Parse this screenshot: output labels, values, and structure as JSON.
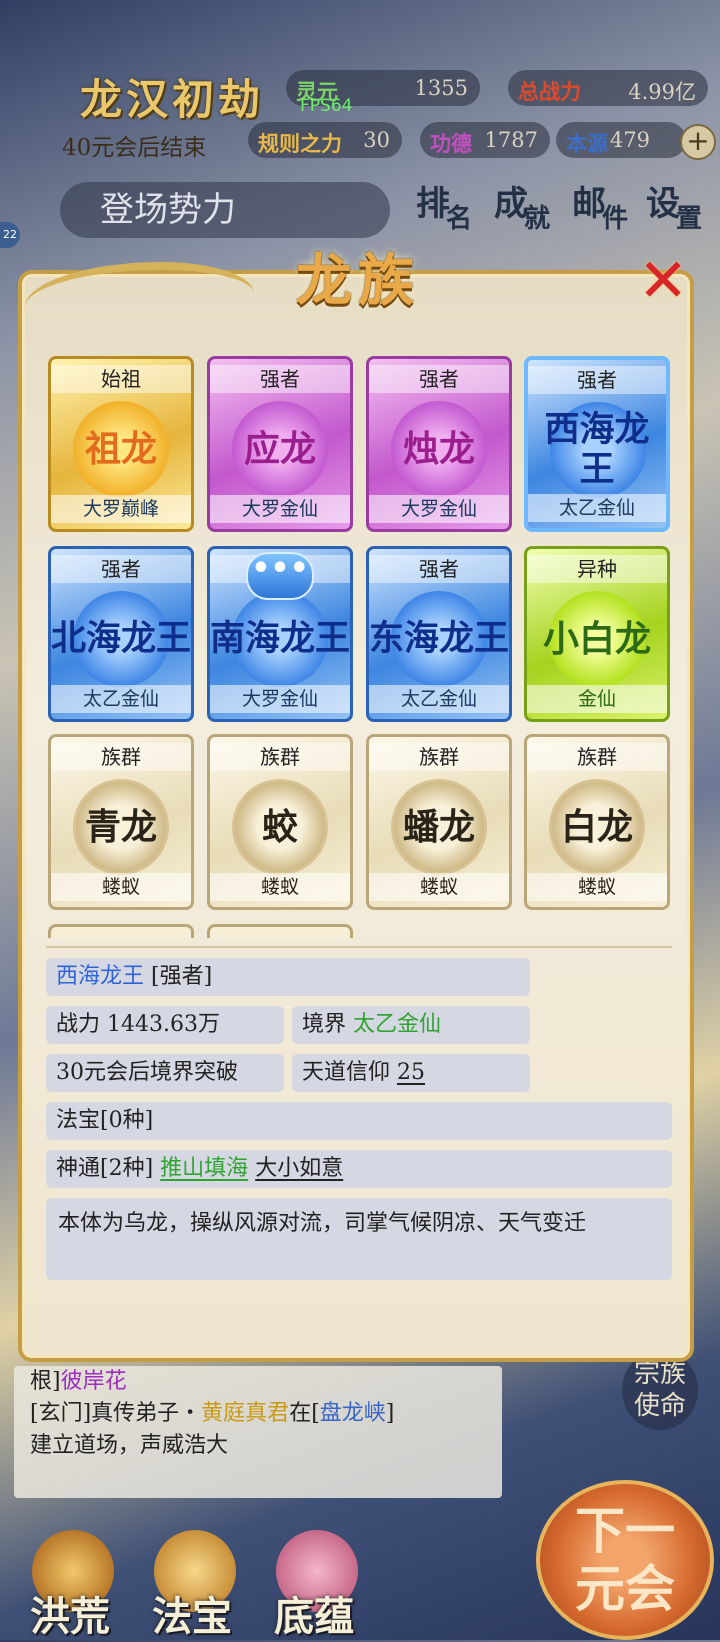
{
  "hud": {
    "title": "龙汉初劫",
    "subtitle": "40元会后结束",
    "fps": "FPS64",
    "stats": [
      {
        "key": "灵元",
        "value": "1355"
      },
      {
        "key": "总战力",
        "value": "4.99亿"
      },
      {
        "key": "规则之力",
        "value": "30"
      },
      {
        "key": "功德",
        "value": "1787"
      },
      {
        "key": "本源",
        "value": "479"
      }
    ],
    "plus": "+",
    "faction_label": "登场势力",
    "level_badge": "22",
    "buttons": [
      {
        "c1": "排",
        "c2": "名"
      },
      {
        "c1": "成",
        "c2": "就"
      },
      {
        "c1": "邮",
        "c2": "件"
      },
      {
        "c1": "设",
        "c2": "置"
      }
    ]
  },
  "modal": {
    "title": "龙族",
    "close_icon": "close-x-icon",
    "cards": [
      {
        "rank": "始祖",
        "name": "祖龙",
        "realm": "大罗巅峰",
        "tier": "gold"
      },
      {
        "rank": "强者",
        "name": "应龙",
        "realm": "大罗金仙",
        "tier": "purple"
      },
      {
        "rank": "强者",
        "name": "烛龙",
        "realm": "大罗金仙",
        "tier": "purple"
      },
      {
        "rank": "强者",
        "name": "西海龙王",
        "realm": "太乙金仙",
        "tier": "blue"
      },
      {
        "rank": "强者",
        "name": "北海龙王",
        "realm": "太乙金仙",
        "tier": "blue"
      },
      {
        "rank": "",
        "name": "南海龙王",
        "realm": "大罗金仙",
        "tier": "blue"
      },
      {
        "rank": "强者",
        "name": "东海龙王",
        "realm": "太乙金仙",
        "tier": "blue"
      },
      {
        "rank": "异种",
        "name": "小白龙",
        "realm": "金仙",
        "tier": "green"
      },
      {
        "rank": "族群",
        "name": "青龙",
        "realm": "蝼蚁",
        "tier": "plain"
      },
      {
        "rank": "族群",
        "name": "蛟",
        "realm": "蝼蚁",
        "tier": "plain"
      },
      {
        "rank": "族群",
        "name": "蟠龙",
        "realm": "蝼蚁",
        "tier": "plain"
      },
      {
        "rank": "族群",
        "name": "白龙",
        "realm": "蝼蚁",
        "tier": "plain"
      }
    ],
    "chat_bubble": "•••",
    "detail": {
      "name": "西海龙王",
      "rank_tag": "[强者]",
      "power_label": "战力",
      "power_value": "1443.63万",
      "realm_label": "境界",
      "realm_value": "太乙金仙",
      "breakthrough": "30元会后境界突破",
      "faith_label": "天道信仰",
      "faith_value": "25",
      "treasure": "法宝[0种]",
      "skills_label": "神通[2种]",
      "skill_1": "推山填海",
      "skill_2": "大小如意",
      "description": "本体为乌龙，操纵风源对流，司掌气候阴凉、天气变迁"
    }
  },
  "log": {
    "line1_a": "根]",
    "line1_b": "彼岸花",
    "line2_a": "[玄门]真传弟子・",
    "line2_b": "黄庭真君",
    "line2_c": "在[",
    "line2_d": "盘龙峡",
    "line2_e": "]",
    "line3": "建立道场，声威浩大"
  },
  "side_button": {
    "l1": "宗族",
    "l2": "使命"
  },
  "bottom": [
    {
      "label": "洪荒"
    },
    {
      "label": "法宝"
    },
    {
      "label": "底蕴"
    }
  ],
  "next_button": {
    "l1": "下一",
    "l2": "元会"
  }
}
